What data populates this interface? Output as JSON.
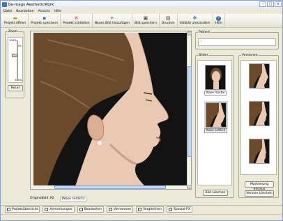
{
  "window": {
    "title": "be-mags AestheticWork"
  },
  "menu": [
    "Datei",
    "Bearbeiten",
    "Ansicht",
    "Hilfe"
  ],
  "toolbar": [
    {
      "label": "Projekt öffnen",
      "icon": "folder-open-icon",
      "glyph": "📂"
    },
    {
      "label": "Projekt speichern",
      "icon": "save-icon",
      "glyph": "💾"
    },
    {
      "label": "Projekt schließen",
      "icon": "close-project-icon",
      "glyph": "✕"
    },
    {
      "label": "Neues Bild hinzufügen",
      "icon": "add-image-icon",
      "glyph": "+"
    },
    {
      "label": "Bild speichern",
      "icon": "save-image-icon",
      "glyph": "▣"
    },
    {
      "label": "Drucken",
      "icon": "print-icon",
      "glyph": "⎙"
    },
    {
      "label": "Vollbild umschalten",
      "icon": "fullscreen-icon",
      "glyph": "⤢"
    },
    {
      "label": "Hilfe",
      "icon": "help-icon",
      "glyph": "?"
    }
  ],
  "zoom": {
    "label": "Zoom",
    "ticks": [
      "100%",
      "0%",
      "300%"
    ],
    "reset": "Reset"
  },
  "main_image": {
    "caption": "Originalbild #2",
    "name": "[Nase seitlich]"
  },
  "patient": {
    "label": "Patient",
    "value": "?"
  },
  "bilder": {
    "label": "Bilder",
    "items": [
      {
        "label": "Nase frontal",
        "selected": false
      },
      {
        "label": "Nase seitlich",
        "selected": true
      }
    ],
    "delete_button": "Bild Löschen"
  },
  "versionen": {
    "label": "Versionen",
    "marker_button": "Markierung ein/aus",
    "delete_button": "Version Löschen"
  },
  "tabs": [
    "Projektübersicht",
    "Anmerkungen",
    "Bearbeiten",
    "Vermessen",
    "Vergleichen",
    "Spezial-FX"
  ],
  "colors": {
    "chrome": "#ece9d8",
    "scroll_thumb": "#c8d7f0",
    "photo_bg": "#161616"
  }
}
